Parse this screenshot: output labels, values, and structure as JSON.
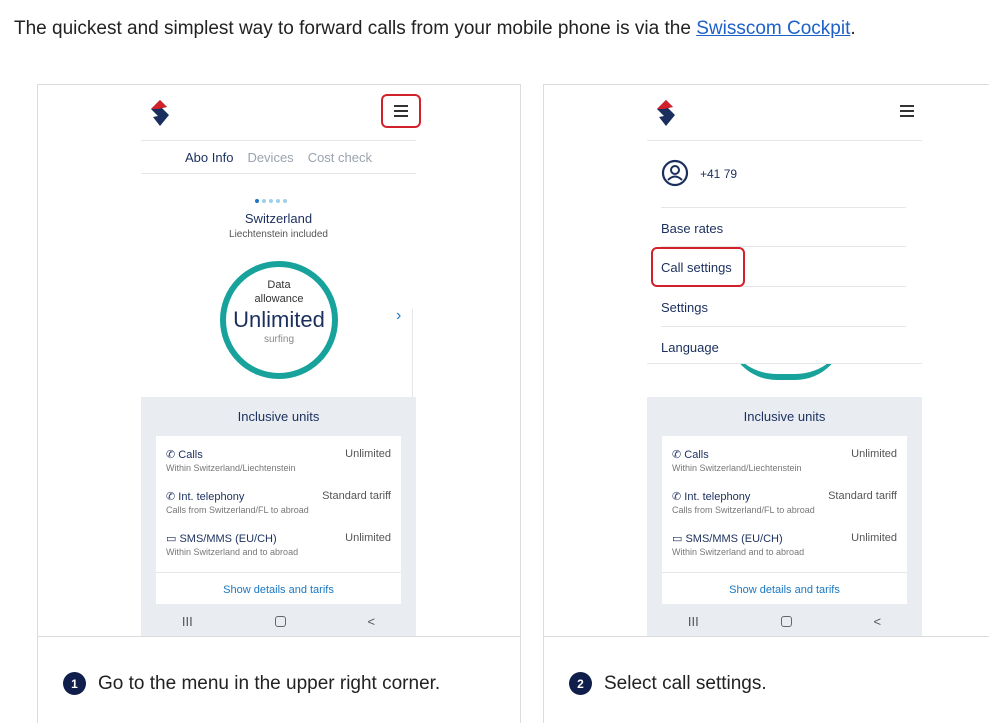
{
  "intro": {
    "text": "The quickest and simplest way to forward calls from your mobile phone is via the ",
    "link": "Swisscom Cockpit",
    "end": "."
  },
  "colors": {
    "brand_red": "#d3212c",
    "ring_teal": "#17a39b",
    "navy": "#1b2f5e",
    "link_blue": "#1a78c2"
  },
  "steps": [
    {
      "number": "1",
      "caption": "Go to the menu in the upper right corner.",
      "tabs": [
        "Abo Info",
        "Devices",
        "Cost check"
      ],
      "country": "Switzerland",
      "country_sub": "Liechtenstein included",
      "ring": {
        "line1": "Data",
        "line2": "allowance",
        "big": "Unlimited",
        "small": "surfing"
      }
    },
    {
      "number": "2",
      "caption": "Select call settings.",
      "phone_number": "+41 79",
      "menu_items": [
        "Base rates",
        "Call settings",
        "Settings",
        "Language"
      ]
    }
  ],
  "units": {
    "title": "Inclusive units",
    "rows": [
      {
        "name": "Calls",
        "value": "Unlimited",
        "sub": "Within Switzerland/Liechtenstein",
        "icon": "phone-icon"
      },
      {
        "name": "Int. telephony",
        "value": "Standard tariff",
        "sub": "Calls from Switzerland/FL to abroad",
        "icon": "phone-icon"
      },
      {
        "name": "SMS/MMS (EU/CH)",
        "value": "Unlimited",
        "sub": "Within Switzerland and to abroad",
        "icon": "message-icon"
      }
    ],
    "details_link": "Show details and tarifs"
  },
  "navbar": {
    "recent": "III",
    "back": "<"
  }
}
